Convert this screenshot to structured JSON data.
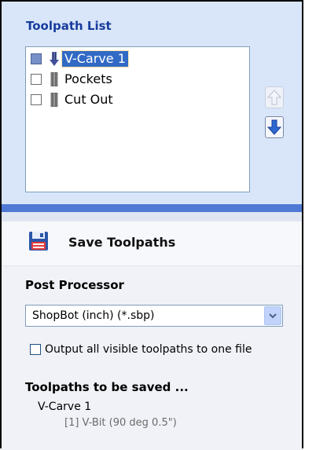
{
  "toolpath_list": {
    "title": "Toolpath List",
    "items": [
      {
        "label": "V-Carve 1",
        "checked": true,
        "selected": true,
        "icon": "vbit-tool-icon"
      },
      {
        "label": "Pockets",
        "checked": false,
        "selected": false,
        "icon": "endmill-tool-icon"
      },
      {
        "label": "Cut Out",
        "checked": false,
        "selected": false,
        "icon": "endmill-tool-icon"
      }
    ],
    "move_up_icon": "arrow-up-icon",
    "move_down_icon": "arrow-down-icon"
  },
  "save_toolpaths": {
    "title": "Save Toolpaths",
    "icon": "floppy-save-icon",
    "post_processor_label": "Post Processor",
    "post_processor_value": "ShopBot (inch) (*.sbp)",
    "output_all_label": "Output all visible toolpaths to one file",
    "output_all_checked": false,
    "to_be_saved_label": "Toolpaths to be saved ...",
    "to_be_saved": [
      {
        "name": "V-Carve 1",
        "detail": "[1] V-Bit (90 deg 0.5\")"
      }
    ]
  },
  "colors": {
    "panel_bg": "#d9e6fa",
    "title_blue": "#173c9c",
    "divider_blue": "#4e7ad6",
    "selection": "#316ac5"
  }
}
